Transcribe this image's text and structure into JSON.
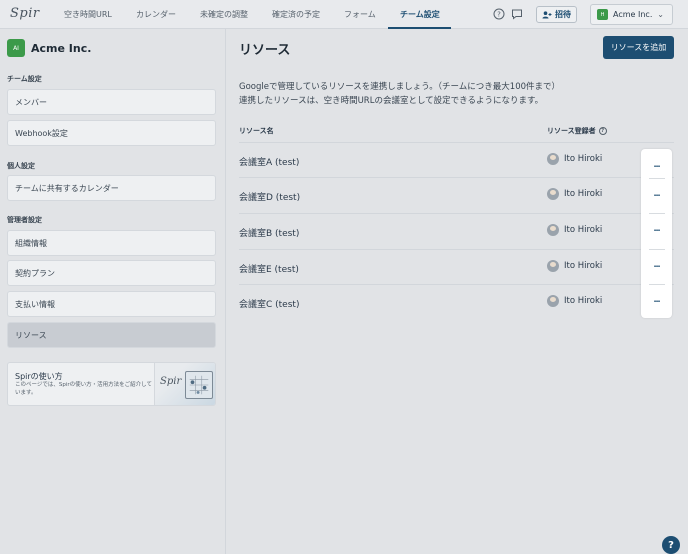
{
  "app": {
    "logo": "Spir"
  },
  "nav": {
    "items": [
      "空き時間URL",
      "カレンダー",
      "未確定の調整",
      "確定済の予定",
      "フォーム",
      "チーム設定"
    ],
    "active_index": 5
  },
  "header": {
    "help_icon": "question-circle-icon",
    "feedback_icon": "chat-bubble-icon",
    "invite_label": "招待",
    "org_initial": "H",
    "org_name": "Acme Inc."
  },
  "sidebar": {
    "org_initial": "AI",
    "org_name": "Acme Inc.",
    "sections": [
      {
        "title": "チーム設定",
        "items": [
          "メンバー",
          "Webhook設定"
        ]
      },
      {
        "title": "個人設定",
        "items": [
          "チームに共有するカレンダー"
        ]
      },
      {
        "title": "管理者設定",
        "items": [
          "組織情報",
          "契約プラン",
          "支払い情報",
          "リソース"
        ]
      }
    ],
    "active_item": "リソース",
    "help_card": {
      "title": "Spirの使い方",
      "description": "このページでは、Spirの使い方・活用方法をご紹介しています。",
      "image_logo": "Spir"
    }
  },
  "main": {
    "title": "リソース",
    "add_button": "リソースを追加",
    "description_line1": "Googleで管理しているリソースを連携しましょう。（チームにつき最大100件まで）",
    "description_line2": "連携したリソースは、空き時間URLの会議室として設定できるようになります。",
    "columns": {
      "name": "リソース名",
      "owner": "リソース登録者"
    },
    "rows": [
      {
        "name": "会議室A (test)",
        "owner": "Ito Hiroki"
      },
      {
        "name": "会議室D (test)",
        "owner": "Ito Hiroki"
      },
      {
        "name": "会議室B (test)",
        "owner": "Ito Hiroki"
      },
      {
        "name": "会議室E (test)",
        "owner": "Ito Hiroki"
      },
      {
        "name": "会議室C (test)",
        "owner": "Ito Hiroki"
      }
    ],
    "row_menu_label": "···"
  },
  "help_fab": "?",
  "colors": {
    "primary": "#1d4e72",
    "org_green": "#3c9a4a",
    "overlay_bg": "#e1e3e6"
  }
}
